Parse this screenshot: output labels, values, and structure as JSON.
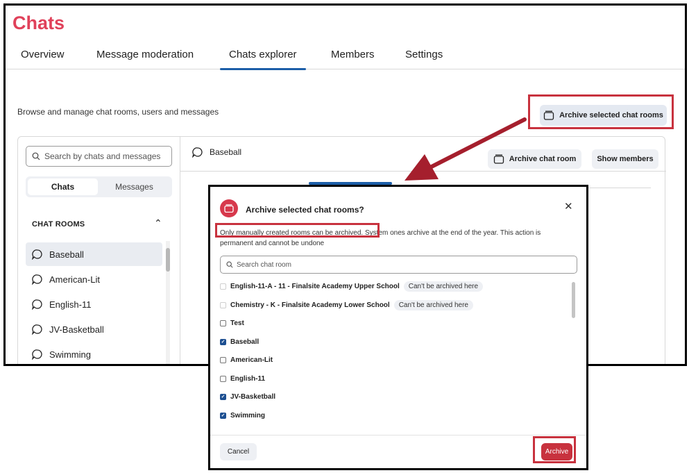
{
  "app": {
    "title": "Chats",
    "accent": "#e0415a"
  },
  "tabs": [
    {
      "label": "Overview"
    },
    {
      "label": "Message moderation"
    },
    {
      "label": "Chats explorer",
      "active": true
    },
    {
      "label": "Members"
    },
    {
      "label": "Settings"
    }
  ],
  "page": {
    "subtitle": "Browse and manage chat rooms, users and messages",
    "archive_selected_label": "Archive selected chat rooms"
  },
  "sidebar": {
    "search_placeholder": "Search by chats and messages",
    "segments": [
      "Chats",
      "Messages"
    ],
    "section_title": "CHAT ROOMS",
    "rooms": [
      "Baseball",
      "American-Lit",
      "English-11",
      "JV-Basketball",
      "Swimming"
    ]
  },
  "main": {
    "room_name": "Baseball",
    "archive_room_label": "Archive chat room",
    "show_members_label": "Show members"
  },
  "modal": {
    "title": "Archive selected chat rooms?",
    "desc_highlight": "Only manually created rooms can be archived.",
    "desc_rest": " System ones archive at the end of the year. This action is permanent and cannot be undone",
    "search_placeholder": "Search chat room",
    "items": [
      {
        "label": "English-11-A - 11 - Finalsite Academy Upper School",
        "badge": "Can't be archived here",
        "state": "disabled"
      },
      {
        "label": "Chemistry - K - Finalsite Academy Lower School",
        "badge": "Can't be archived here",
        "state": "disabled"
      },
      {
        "label": "Test",
        "state": "unchecked"
      },
      {
        "label": "Baseball",
        "state": "checked"
      },
      {
        "label": "American-Lit",
        "state": "unchecked"
      },
      {
        "label": "English-11",
        "state": "unchecked"
      },
      {
        "label": "JV-Basketball",
        "state": "checked"
      },
      {
        "label": "Swimming",
        "state": "checked"
      }
    ],
    "cancel_label": "Cancel",
    "archive_label": "Archive"
  },
  "colors": {
    "highlight": "#c8323e",
    "tab_underline": "#1c5ea8",
    "checkbox": "#1d4f91"
  }
}
